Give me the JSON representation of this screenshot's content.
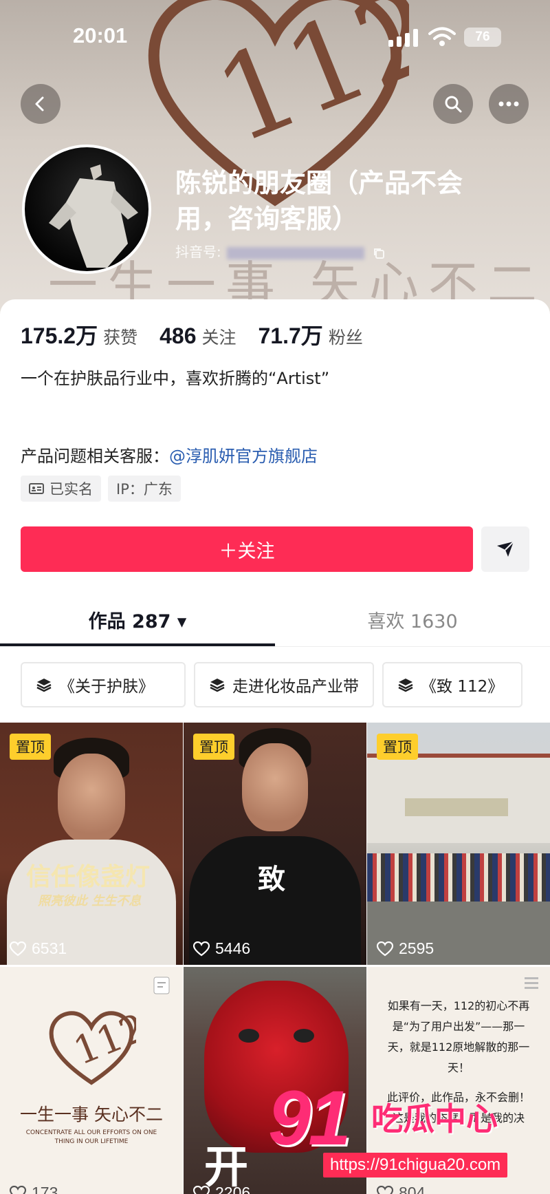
{
  "status_bar": {
    "time": "20:01",
    "battery": "76"
  },
  "profile": {
    "name": "陈锐的朋友圈（产品不会用，咨询客服）",
    "douyin_id_label": "抖音号:",
    "stats": [
      {
        "value": "175.2万",
        "label": "获赞"
      },
      {
        "value": "486",
        "label": "关注"
      },
      {
        "value": "71.7万",
        "label": "粉丝"
      }
    ],
    "bio": "一个在护肤品行业中，喜欢折腾的“Artist”",
    "service_label": "产品问题相关客服：",
    "service_link": "@淳肌妍官方旗舰店",
    "tags": [
      "已实名",
      "IP：广东"
    ],
    "follow_label": "＋关注"
  },
  "banner": {
    "motto": "一生一事 矢心不二"
  },
  "tabs": [
    {
      "label": "作品 287 ▾"
    },
    {
      "label": "喜欢 1630"
    }
  ],
  "collections": [
    "《关于护肤》",
    "走进化妆品产业带",
    "《致 112》"
  ],
  "videos": [
    {
      "pinned": "置顶",
      "likes": "6531",
      "caption": "信任像盏灯",
      "subcaption": "照亮彼此 生生不息"
    },
    {
      "pinned": "置顶",
      "likes": "5446",
      "caption": "致"
    },
    {
      "pinned": "置顶",
      "likes": "2595",
      "caption": ""
    },
    {
      "likes": "173",
      "caption": "一生一事 矢心不二",
      "subcaption": "CONCENTRATE ALL OUR EFFORTS ON ONE THING IN OUR LIFETIME"
    },
    {
      "likes": "2206",
      "caption": "开"
    },
    {
      "likes": "804",
      "caption": "如果有一天，112的初心不再是“为了用户出发”——那一天，就是112原地解散的那一天！",
      "caption2": "此评价，此作品，永不会删！这是我的态度，更是我的决"
    }
  ],
  "watermark": {
    "brand": "91",
    "name": "吃瓜中心",
    "url": "https://91chigua20.com"
  },
  "colors": {
    "accent": "#fe2c55",
    "link": "#2a5db0",
    "pin": "#fece2c"
  }
}
